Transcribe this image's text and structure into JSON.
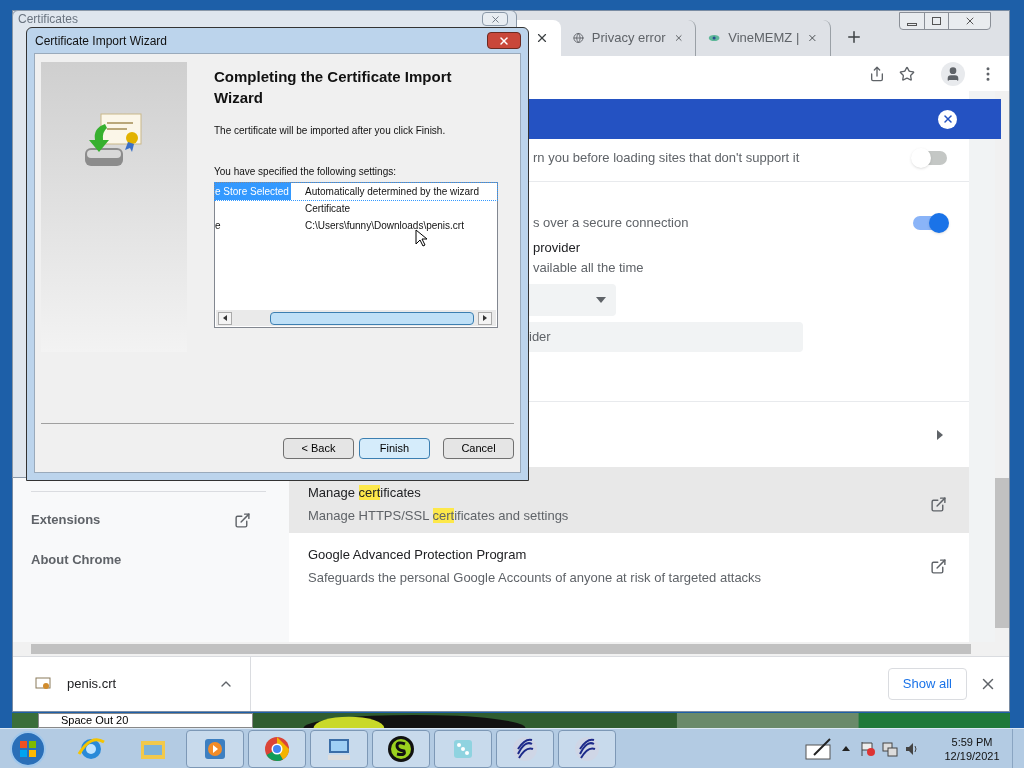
{
  "certificates_window": {
    "title": "Certificates"
  },
  "wizard": {
    "title": "Certificate Import Wizard",
    "heading": "Completing the Certificate Import Wizard",
    "intro": "The certificate will be imported after you click Finish.",
    "settings_label": "You have specified the following settings:",
    "settings": [
      {
        "setting": "e Store Selected",
        "value": "Automatically determined by the wizard",
        "selected": true
      },
      {
        "value": "Certificate",
        "selected": false
      },
      {
        "setting": "e",
        "value": "C:\\Users\\funny\\Downloads\\penis.crt",
        "selected": false
      }
    ],
    "buttons": [
      {
        "label": "< Back",
        "default": false
      },
      {
        "label": "Finish",
        "default": true
      },
      {
        "label": "Cancel",
        "default": false
      }
    ]
  },
  "browser": {
    "tabs": [
      {
        "selected": true
      },
      {
        "title": "Privacy error",
        "selected": false
      },
      {
        "title": "VineMEMZ |",
        "selected": false
      }
    ],
    "partial_rows": [
      {
        "kind": "toggle-text",
        "text": "rn you before loading sites that don't support it",
        "on": false
      },
      {
        "kind": "toggle-text",
        "text": "s over a secure connection",
        "on": true
      },
      {
        "kind": "text",
        "text": "provider",
        "secondary": false
      },
      {
        "kind": "text",
        "text": "vailable all the time",
        "secondary": true
      },
      {
        "kind": "dropdown"
      },
      {
        "kind": "field",
        "value": "ider"
      }
    ],
    "links": [
      {
        "parts": [
          {
            "text": "Manage ",
            "highlighted": false
          },
          {
            "text": "cert",
            "highlighted": true
          },
          {
            "text": "ificates",
            "highlighted": false
          }
        ],
        "sub_parts": [
          {
            "text": "Manage HTTPS/SSL ",
            "highlighted": false
          },
          {
            "text": "cert",
            "highlighted": true
          },
          {
            "text": "ificates and settings",
            "highlighted": false
          }
        ],
        "hovered": true
      },
      {
        "parts": [
          {
            "text": "Google Advanced Protection Program",
            "highlighted": false
          }
        ],
        "sub_parts": [
          {
            "text": "Safeguards the personal Google Accounts of anyone at risk of targeted attacks",
            "highlighted": false
          }
        ],
        "hovered": false
      }
    ],
    "sidebar": [
      {
        "label": "Extensions",
        "external": true
      },
      {
        "label": "About Chrome",
        "external": false
      }
    ],
    "download": {
      "file": "penis.crt",
      "show_all": "Show all"
    }
  },
  "background_window": {
    "title": "Space Out 20"
  },
  "taskbar": {
    "time": "5:59 PM",
    "date": "12/19/2021"
  }
}
